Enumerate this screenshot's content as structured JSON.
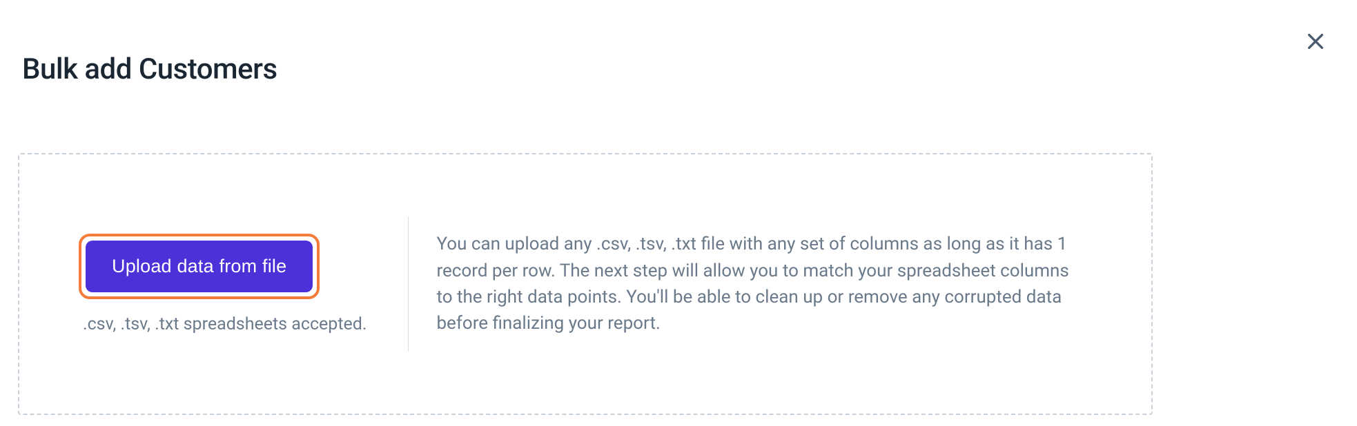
{
  "modal": {
    "title": "Bulk add Customers",
    "close_label": "Close"
  },
  "upload": {
    "button_label": "Upload data from file",
    "accepted_formats": ".csv, .tsv, .txt spreadsheets accepted.",
    "description": "You can upload any .csv, .tsv, .txt file with any set of columns as long as it has 1 record per row. The next step will allow you to match your spreadsheet columns to the right data points. You'll be able to clean up or remove any corrupted data before finalizing your report."
  }
}
